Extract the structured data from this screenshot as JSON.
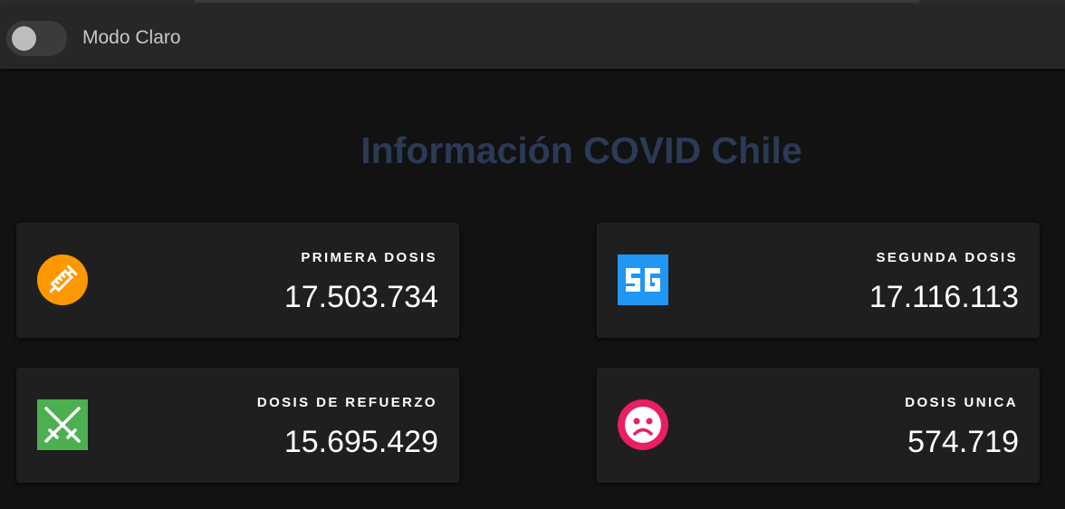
{
  "appbar": {
    "mode_toggle_label": "Modo Claro",
    "mode_toggle_on": false
  },
  "page": {
    "title": "Información COVID Chile"
  },
  "cards": [
    {
      "label": "PRIMERA DOSIS",
      "value": "17.503.734",
      "icon": "syringe-icon",
      "icon_color": "#ff9800"
    },
    {
      "label": "SEGUNDA DOSIS",
      "value": "17.116.113",
      "icon": "5g-icon",
      "icon_color": "#2196f3"
    },
    {
      "label": "DOSIS DE REFUERZO",
      "value": "15.695.429",
      "icon": "crossed-syringes-icon",
      "icon_color": "#4caf50"
    },
    {
      "label": "DOSIS UNICA",
      "value": "574.719",
      "icon": "sad-face-icon",
      "icon_color": "#e91e63"
    }
  ],
  "colors": {
    "background": "#121212",
    "appbar": "#272727",
    "card": "#1f1f1f",
    "title": "#2b3a55"
  }
}
